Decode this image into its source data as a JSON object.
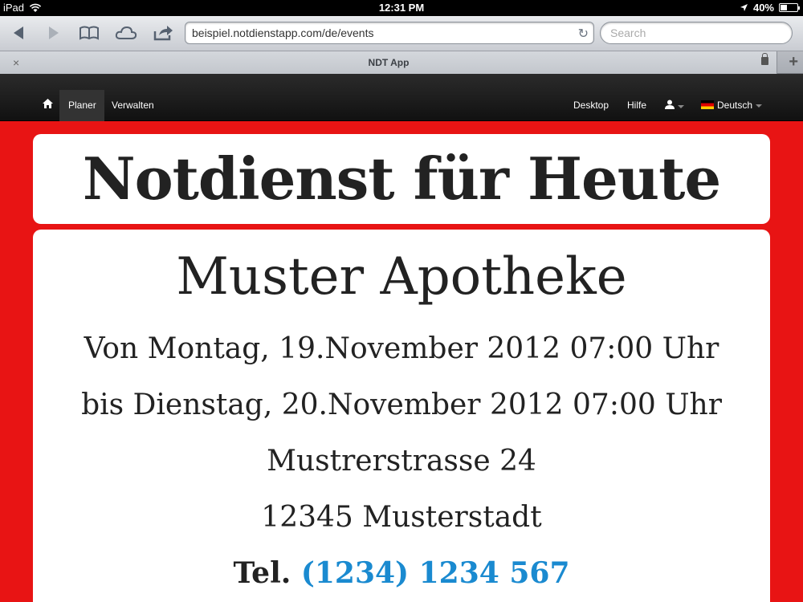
{
  "status_bar": {
    "device": "iPad",
    "time": "12:31 PM",
    "battery": "40%",
    "battery_level": 0.4
  },
  "browser": {
    "url": "beispiel.notdienstapp.com/de/events",
    "search_placeholder": "Search",
    "tab_title": "NDT App",
    "tab_close": "×",
    "new_tab": "+"
  },
  "nav": {
    "planer": "Planer",
    "verwalten": "Verwalten",
    "desktop": "Desktop",
    "hilfe": "Hilfe",
    "language": "Deutsch"
  },
  "main": {
    "heading": "Notdienst für Heute",
    "pharmacy_name": "Muster Apotheke",
    "from": "Von Montag, 19.November 2012 07:00 Uhr",
    "to": "bis Dienstag, 20.November 2012 07:00 Uhr",
    "street": "Mustrerstrasse 24",
    "city": "12345 Musterstadt",
    "tel_label": "Tel.",
    "tel_number": "(1234) 1234 567"
  },
  "colors": {
    "background": "#e81414",
    "link": "#1a8ad0",
    "navbar": "#1b1b1b"
  },
  "icons": [
    "wifi-icon",
    "location-arrow-icon",
    "back-icon",
    "forward-icon",
    "bookmarks-icon",
    "icloud-icon",
    "share-icon",
    "reload-icon",
    "lock-icon",
    "home-icon",
    "user-icon",
    "flag-de-icon"
  ]
}
